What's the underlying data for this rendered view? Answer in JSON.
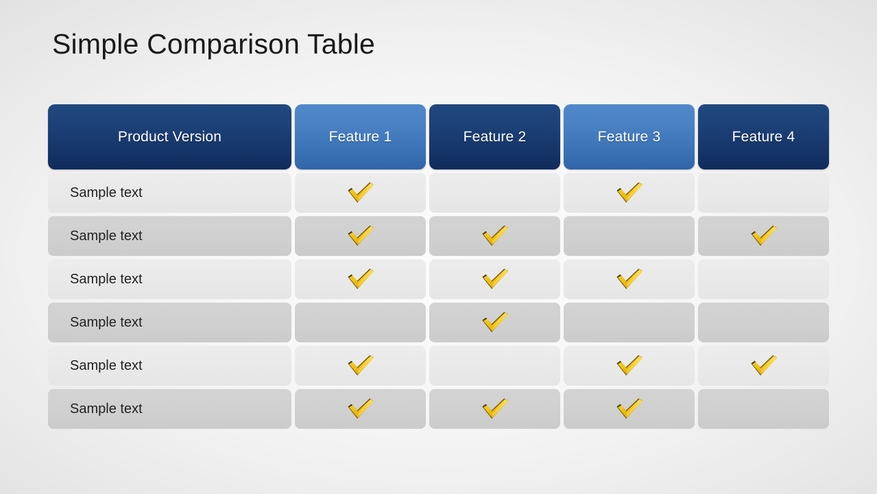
{
  "slide": {
    "title": "Simple Comparison Table",
    "background_center": "#fbfbfb",
    "background_edge": "#e0e0e0"
  },
  "palette": {
    "header_dark": "#1a3f76",
    "header_light": "#4a82c4",
    "header_text": "#ffffff",
    "row_light": "#e9e9e9",
    "row_dark": "#d0d0d0",
    "body_text": "#222222",
    "check_gold": "#f5c513",
    "check_shadow": "#4a3a0a",
    "title_text": "#1a1a1a"
  },
  "table": {
    "columns": [
      {
        "label": "Product Version",
        "style": "dark"
      },
      {
        "label": "Feature 1",
        "style": "light"
      },
      {
        "label": "Feature 2",
        "style": "dark"
      },
      {
        "label": "Feature 3",
        "style": "light"
      },
      {
        "label": "Feature 4",
        "style": "dark"
      }
    ],
    "check_icon": "check-mark-icon",
    "rows": [
      {
        "label": "Sample text",
        "shade": "light",
        "checks": [
          true,
          false,
          true,
          false
        ]
      },
      {
        "label": "Sample text",
        "shade": "dark",
        "checks": [
          true,
          true,
          false,
          true
        ]
      },
      {
        "label": "Sample text",
        "shade": "light",
        "checks": [
          true,
          true,
          true,
          false
        ]
      },
      {
        "label": "Sample text",
        "shade": "dark",
        "checks": [
          false,
          true,
          false,
          false
        ]
      },
      {
        "label": "Sample text",
        "shade": "light",
        "checks": [
          true,
          false,
          true,
          true
        ]
      },
      {
        "label": "Sample text",
        "shade": "dark",
        "checks": [
          true,
          true,
          true,
          false
        ]
      }
    ]
  }
}
